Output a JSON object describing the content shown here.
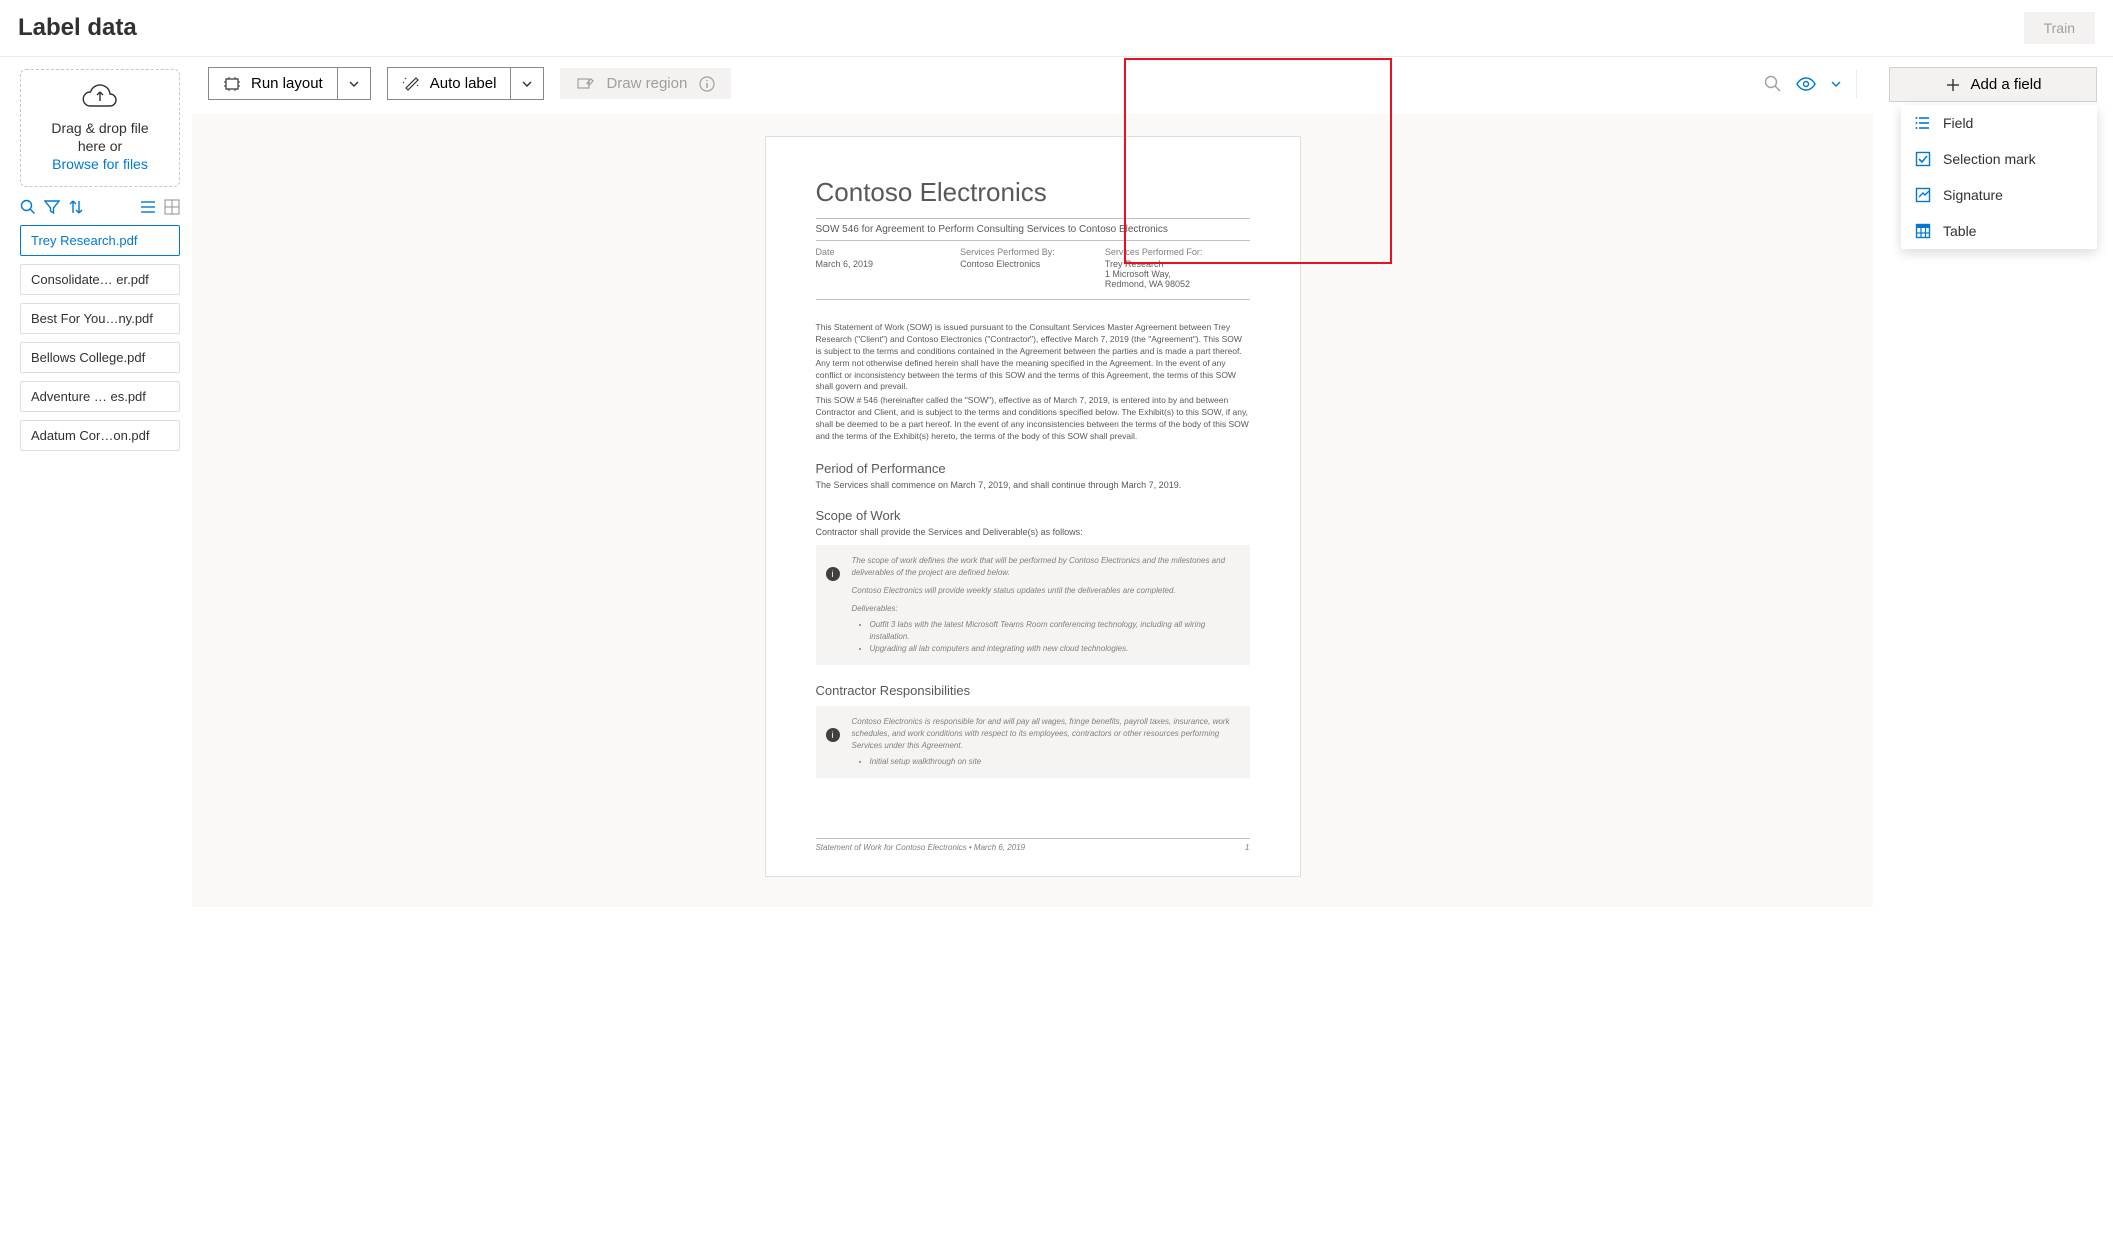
{
  "header": {
    "title": "Label data",
    "train_btn": "Train"
  },
  "sidebar": {
    "dropzone": {
      "line1": "Drag & drop file",
      "line2": "here or",
      "browse": "Browse for files"
    },
    "files": [
      {
        "name": "Trey Research.pdf",
        "selected": true
      },
      {
        "name": "Consolidate… er.pdf",
        "selected": false
      },
      {
        "name": "Best For You…ny.pdf",
        "selected": false
      },
      {
        "name": "Bellows College.pdf",
        "selected": false
      },
      {
        "name": "Adventure … es.pdf",
        "selected": false
      },
      {
        "name": "Adatum Cor…on.pdf",
        "selected": false
      }
    ]
  },
  "toolbar": {
    "run_layout": "Run layout",
    "auto_label": "Auto label",
    "draw_region": "Draw region"
  },
  "fields": {
    "add_field": "Add a field",
    "dropdown": {
      "field": "Field",
      "selection_mark": "Selection mark",
      "signature": "Signature",
      "table": "Table"
    }
  },
  "doc": {
    "title": "Contoso Electronics",
    "sow": "SOW 546 for Agreement to Perform Consulting Services to Contoso Electronics",
    "meta": {
      "date_lbl": "Date",
      "date_val": "March 6, 2019",
      "by_lbl": "Services Performed By:",
      "by_val": "Contoso Electronics",
      "for_lbl": "Services Performed For:",
      "for_val1": "Trey Research",
      "for_val2": "1 Microsoft Way,",
      "for_val3": "Redmond, WA 98052"
    },
    "para1": "This Statement of Work (SOW) is issued pursuant to the Consultant Services Master Agreement between Trey Research (\"Client\") and Contoso Electronics (\"Contractor\"), effective March 7, 2019 (the \"Agreement\"). This SOW is subject to the terms and conditions contained in the Agreement between the parties and is made a part thereof. Any term not otherwise defined herein shall have the meaning specified in the Agreement. In the event of any conflict or inconsistency between the terms of this SOW and the terms of this Agreement, the terms of this SOW shall govern and prevail.",
    "para2": "This SOW # 546 (hereinafter called the \"SOW\"), effective as of March 7, 2019, is entered into by and between Contractor and Client, and is subject to the terms and conditions specified below. The Exhibit(s) to this SOW, if any, shall be deemed to be a part hereof. In the event of any inconsistencies between the terms of the body of this SOW and the terms of the Exhibit(s) hereto, the terms of the body of this SOW shall prevail.",
    "period_h": "Period of Performance",
    "period_t": "The Services shall commence on March 7, 2019, and shall continue through March 7, 2019.",
    "scope_h": "Scope of Work",
    "scope_t": "Contractor shall provide the Services and Deliverable(s) as follows:",
    "callout1": {
      "l1": "The scope of work defines the work that will be performed by Contoso Electronics and the milestones and deliverables of the project are defined below.",
      "l2": "Contoso Electronics will provide weekly status updates until the deliverables are completed.",
      "l3": "Deliverables:",
      "b1": "Outfit 3 labs with the latest Microsoft Teams Room conferencing technology, including all wiring installation.",
      "b2": "Upgrading all lab computers and integrating with new cloud technologies."
    },
    "resp_h": "Contractor Responsibilities",
    "callout2": {
      "l1": "Contoso Electronics is responsible for and will pay all wages, fringe benefits, payroll taxes, insurance, work schedules, and work conditions with respect to its employees, contractors or other resources performing Services under this Agreement.",
      "b1": "Initial setup walkthrough on site"
    },
    "footer_l": "Statement of Work for Contoso Electronics  • March 6, 2019",
    "footer_r": "1"
  }
}
